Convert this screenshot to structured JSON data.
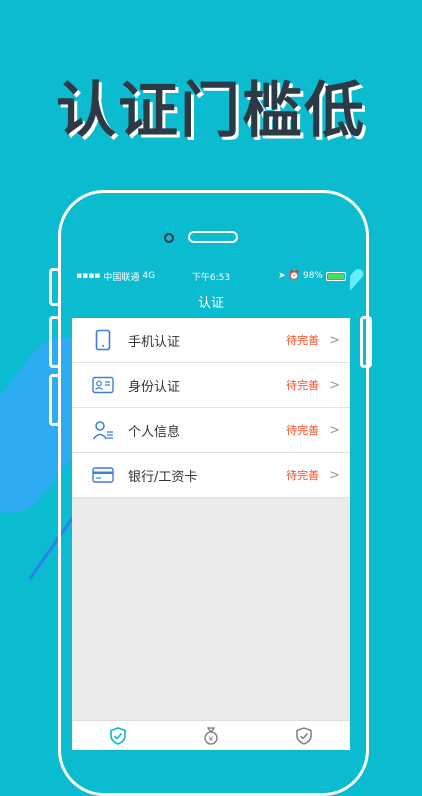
{
  "promo": {
    "headline": "认证门槛低"
  },
  "status_bar": {
    "carrier": "中国联通",
    "network": "4G",
    "time": "下午6:53",
    "battery": "98%"
  },
  "nav": {
    "title": "认证"
  },
  "items": [
    {
      "label": "手机认证",
      "status": "待完善",
      "icon": "phone-icon"
    },
    {
      "label": "身份认证",
      "status": "待完善",
      "icon": "id-card-icon"
    },
    {
      "label": "个人信息",
      "status": "待完善",
      "icon": "person-icon"
    },
    {
      "label": "银行/工资卡",
      "status": "待完善",
      "icon": "bank-card-icon"
    }
  ],
  "tabbar": {
    "tabs": [
      {
        "icon": "shield-check-icon",
        "active": true
      },
      {
        "icon": "money-bag-icon",
        "active": false
      },
      {
        "icon": "shield-icon",
        "active": false
      }
    ]
  },
  "colors": {
    "brand": "#0BBBD0",
    "status": "#FF4A1A",
    "dark_text": "#2B3A45"
  }
}
